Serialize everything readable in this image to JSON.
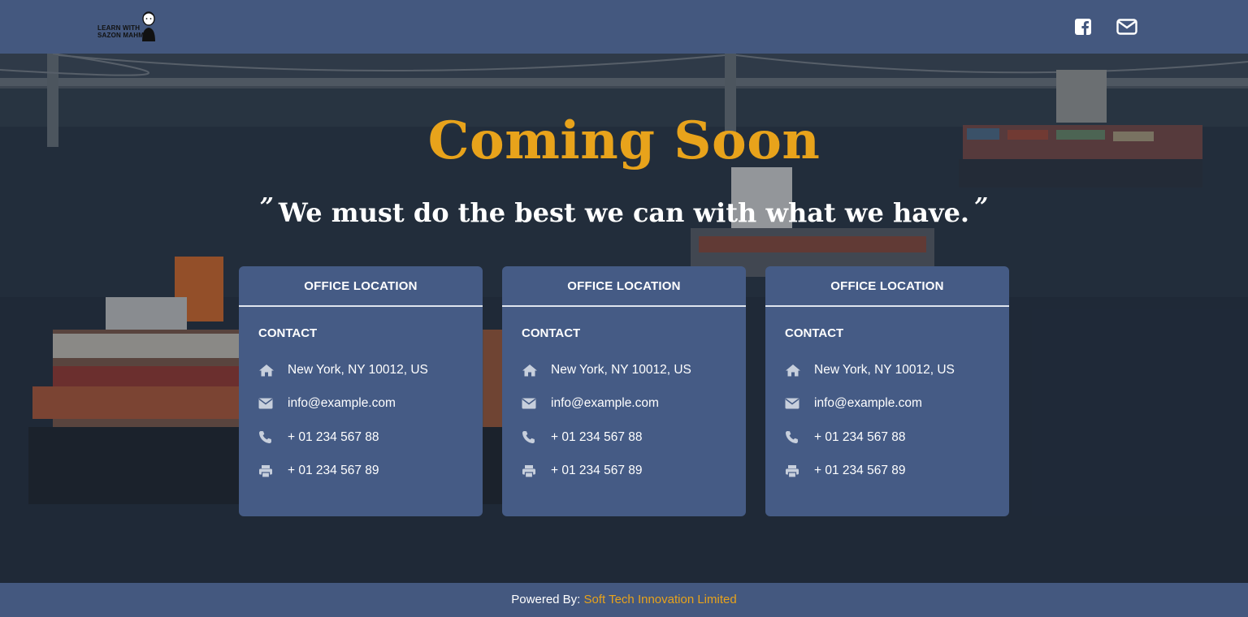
{
  "header": {
    "logo_line1": "LEARN WITH",
    "logo_line2": "SAZON MAHMUD",
    "social_icons": [
      "facebook-icon",
      "envelope-icon"
    ]
  },
  "hero": {
    "title": "Coming Soon",
    "quote_open": "”",
    "quote_text": "We must do the best we can with what we have.",
    "quote_close": "”"
  },
  "cards": [
    {
      "heading": "OFFICE LOCATION",
      "contact_title": "CONTACT",
      "address": "New York, NY 10012, US",
      "email": "info@example.com",
      "phone": "+ 01 234 567 88",
      "fax": "+ 01 234 567 89"
    },
    {
      "heading": "OFFICE LOCATION",
      "contact_title": "CONTACT",
      "address": "New York, NY 10012, US",
      "email": "info@example.com",
      "phone": "+ 01 234 567 88",
      "fax": "+ 01 234 567 89"
    },
    {
      "heading": "OFFICE LOCATION",
      "contact_title": "CONTACT",
      "address": "New York, NY 10012, US",
      "email": "info@example.com",
      "phone": "+ 01 234 567 88",
      "fax": "+ 01 234 567 89"
    }
  ],
  "footer": {
    "prefix": "Powered By:",
    "brand": "Soft Tech Innovation Limited"
  },
  "colors": {
    "bar": "#44587f",
    "card": "#455b85",
    "accent": "#e8a31b"
  }
}
